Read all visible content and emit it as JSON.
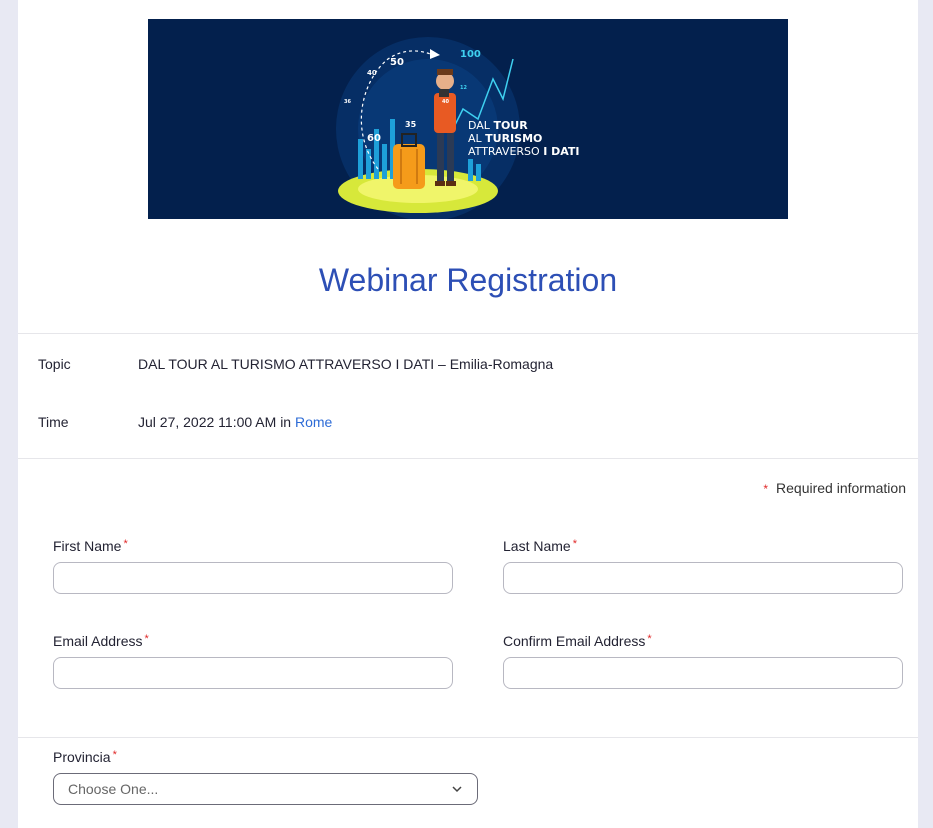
{
  "banner": {
    "line1": "DAL",
    "line1_bold": "TOUR",
    "line2": "AL",
    "line2_bold": "TURISMO",
    "line3": "ATTRAVERSO",
    "line3_bold": "I DATI",
    "numbers": [
      "50",
      "100",
      "40",
      "36",
      "35",
      "40",
      "12",
      "60"
    ]
  },
  "title": "Webinar Registration",
  "info": {
    "topic_label": "Topic",
    "topic_value": "DAL TOUR AL TURISMO ATTRAVERSO I DATI – Emilia-Romagna",
    "time_label": "Time",
    "time_value": "Jul 27, 2022 11:00 AM",
    "time_in": "in",
    "time_zone": "Rome"
  },
  "form": {
    "required_star": "*",
    "required_note": "Required information",
    "first_name_label": "First Name",
    "last_name_label": "Last Name",
    "email_label": "Email Address",
    "confirm_email_label": "Confirm Email Address",
    "provincia_label": "Provincia",
    "provincia_selected": "Choose One..."
  },
  "colors": {
    "accent": "#2d4fb5",
    "banner_bg": "#03204d",
    "required": "#e02828"
  }
}
